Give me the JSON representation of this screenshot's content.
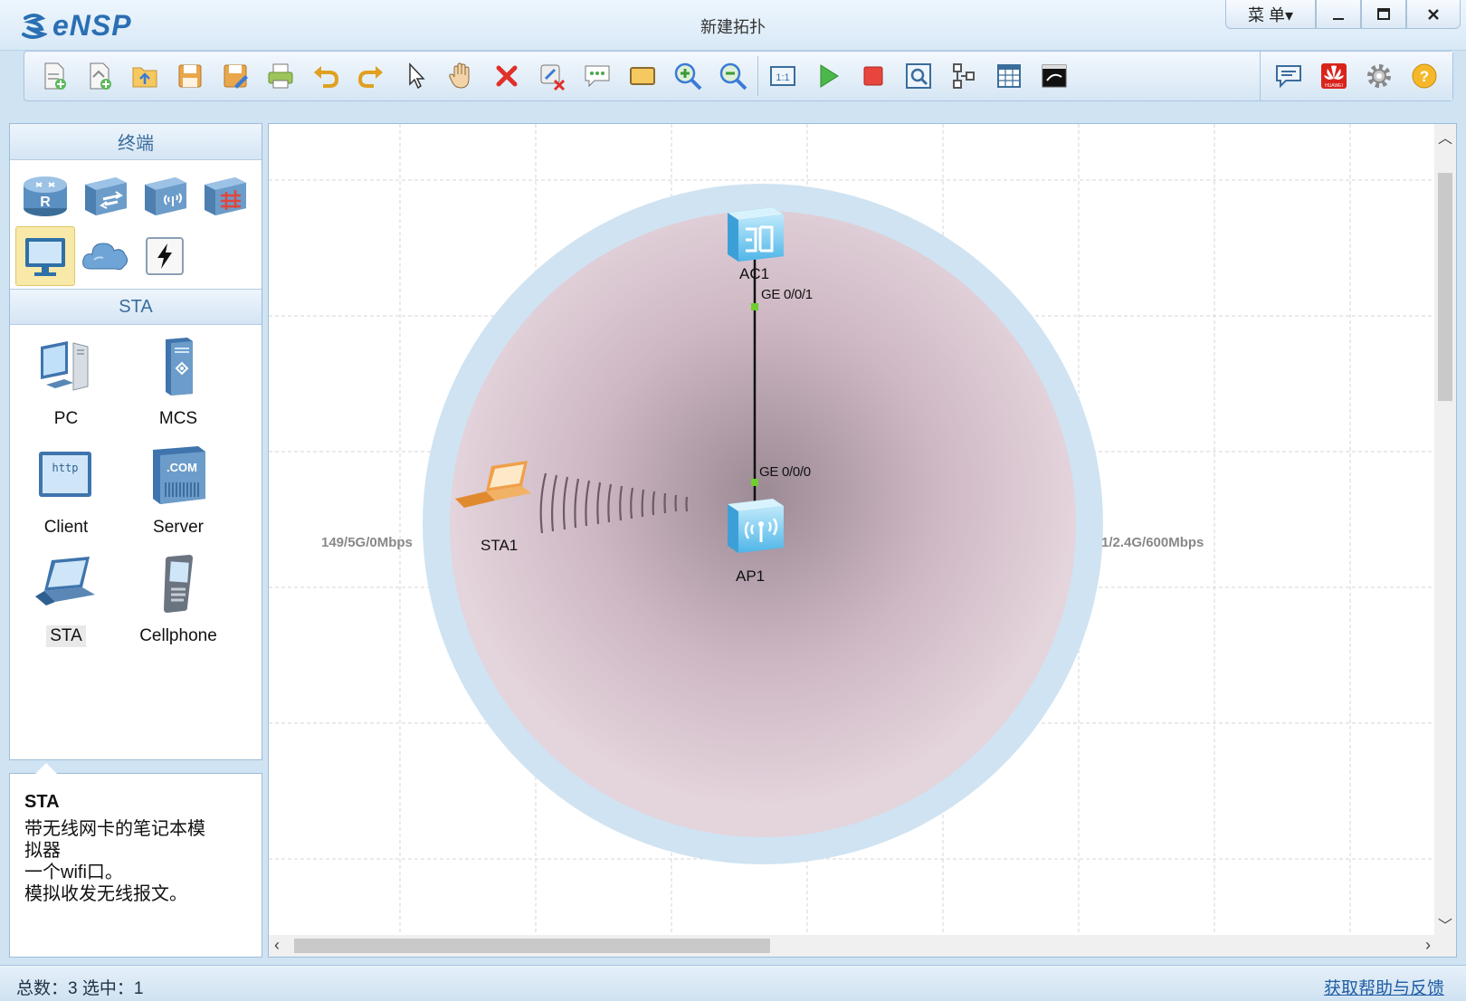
{
  "app": {
    "name": "eNSP",
    "window_title": "新建拓扑",
    "menu_label": "菜 单▾"
  },
  "toolbar": {
    "items": [
      "new-topology",
      "new-lab",
      "open",
      "save",
      "save-as",
      "print",
      "undo",
      "redo",
      "select",
      "pan",
      "delete",
      "delete-link",
      "add-text",
      "add-shape",
      "zoom-in",
      "zoom-out",
      "fit",
      "start-devices",
      "stop-devices",
      "capture",
      "topology-view",
      "palette",
      "terminal"
    ],
    "right_items": [
      "message",
      "huawei-logo",
      "settings",
      "help"
    ]
  },
  "left_panel": {
    "category_header": "终端",
    "categories": [
      {
        "name": "router",
        "selected": false
      },
      {
        "name": "switch",
        "selected": false
      },
      {
        "name": "wlan",
        "selected": false
      },
      {
        "name": "firewall",
        "selected": false
      },
      {
        "name": "terminal",
        "selected": true
      },
      {
        "name": "cloud",
        "selected": false
      },
      {
        "name": "cable",
        "selected": false
      }
    ],
    "device_header": "STA",
    "devices": [
      {
        "label": "PC",
        "icon": "pc-icon",
        "selected": false
      },
      {
        "label": "MCS",
        "icon": "mcs-icon",
        "selected": false
      },
      {
        "label": "Client",
        "icon": "client-icon",
        "selected": false
      },
      {
        "label": "Server",
        "icon": "server-icon",
        "selected": false
      },
      {
        "label": "STA",
        "icon": "laptop-icon",
        "selected": true
      },
      {
        "label": "Cellphone",
        "icon": "cellphone-icon",
        "selected": false
      }
    ]
  },
  "description": {
    "title": "STA",
    "lines": [
      "带无线网卡的笔记本模",
      "拟器",
      "一个wifi口。",
      "模拟收发无线报文。"
    ]
  },
  "canvas": {
    "nodes": {
      "ac1": "AC1",
      "ap1": "AP1",
      "sta1": "STA1"
    },
    "ports": {
      "ac1_port": "GE 0/0/1",
      "ap1_port": "GE 0/0/0"
    },
    "ranges": {
      "left": "149/5G/0Mbps",
      "right": "1/2.4G/600Mbps"
    }
  },
  "status": {
    "text": "总数：3  选中：1",
    "help_link": "获取帮助与反馈"
  }
}
